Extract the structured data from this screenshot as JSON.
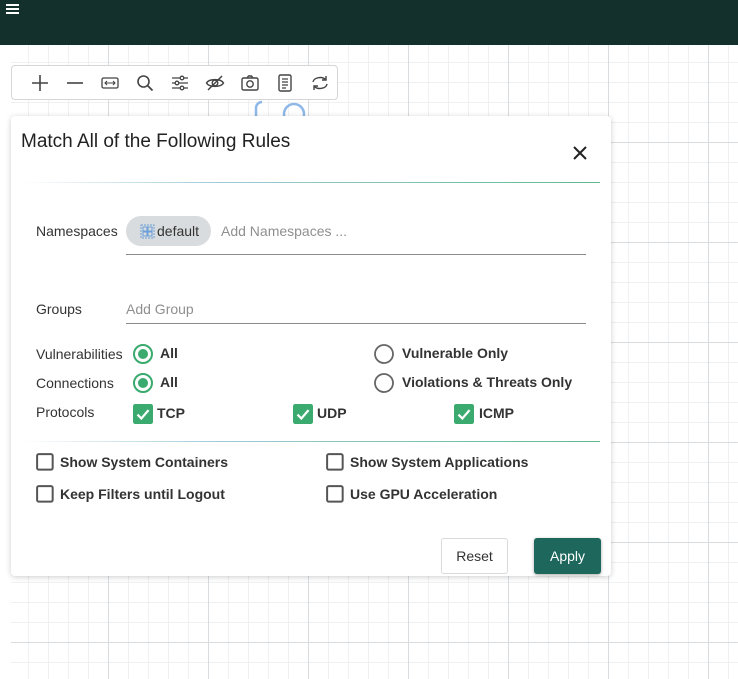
{
  "topbar": {
    "menu_icon": "hamburger-icon",
    "color": "#14302c"
  },
  "toolbar": {
    "tools": [
      "zoom-in-icon",
      "zoom-out-icon",
      "fit-to-screen-icon",
      "search-icon",
      "filter-settings-icon",
      "hide-icon",
      "camera-icon",
      "document-icon",
      "refresh-icon"
    ]
  },
  "dialog": {
    "title": "Match All of the Following Rules",
    "close_icon": "close-icon",
    "namespaces": {
      "label": "Namespaces",
      "chip": "default",
      "chip_icon": "namespace-icon",
      "placeholder": "Add Namespaces ..."
    },
    "groups": {
      "label": "Groups",
      "placeholder": "Add Group"
    },
    "vulnerabilities": {
      "label": "Vulnerabilities",
      "options": [
        {
          "label": "All",
          "selected": true
        },
        {
          "label": "Vulnerable Only",
          "selected": false
        }
      ]
    },
    "connections": {
      "label": "Connections",
      "options": [
        {
          "label": "All",
          "selected": true
        },
        {
          "label": "Violations & Threats Only",
          "selected": false
        }
      ]
    },
    "protocols": {
      "label": "Protocols",
      "options": [
        {
          "label": "TCP",
          "checked": true
        },
        {
          "label": "UDP",
          "checked": true
        },
        {
          "label": "ICMP",
          "checked": true
        }
      ]
    },
    "options": [
      {
        "label": "Show System Containers",
        "checked": false
      },
      {
        "label": "Show System Applications",
        "checked": false
      },
      {
        "label": "Keep Filters until Logout",
        "checked": false
      },
      {
        "label": "Use GPU Acceleration",
        "checked": false
      }
    ],
    "reset_label": "Reset",
    "apply_label": "Apply"
  },
  "colors": {
    "accent": "#1d675c",
    "check_green": "#3aaa6e",
    "topbar": "#14302c"
  }
}
